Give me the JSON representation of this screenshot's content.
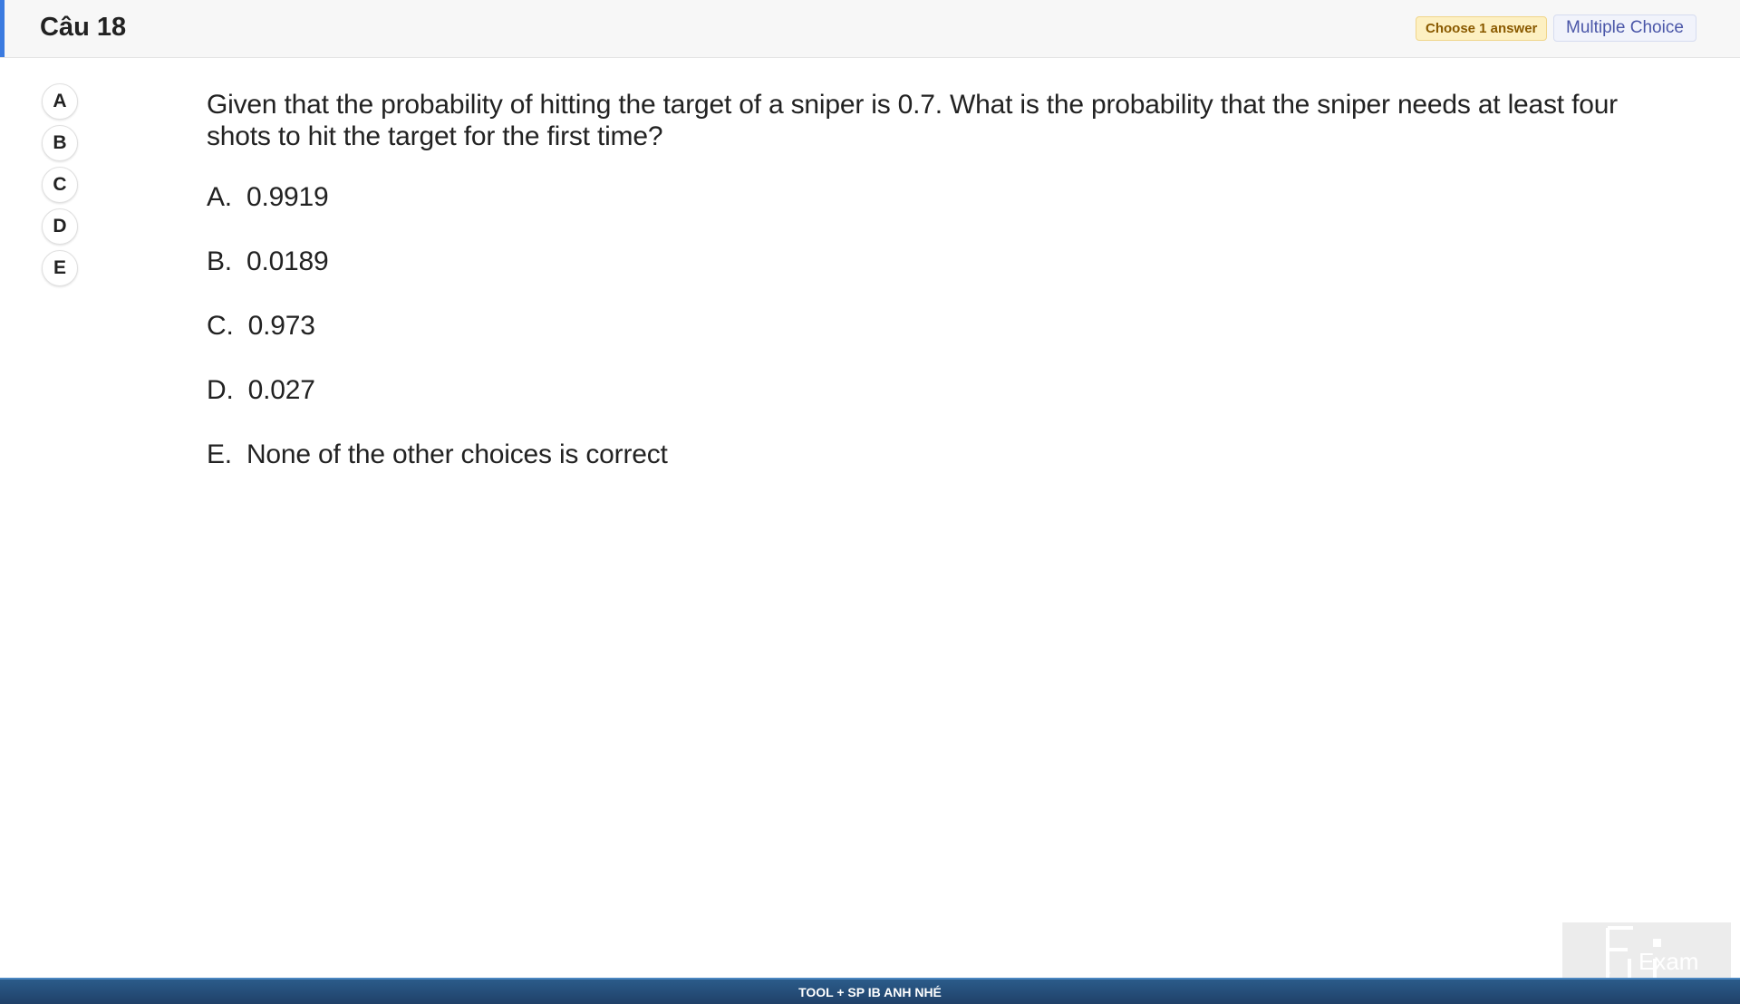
{
  "header": {
    "question_number": "Câu 18",
    "badge_choose": "Choose 1 answer",
    "badge_type": "Multiple Choice",
    "accent_color": "#3b7be0"
  },
  "answer_circles": [
    "A",
    "B",
    "C",
    "D",
    "E"
  ],
  "question": {
    "text": "Given that the probability of hitting the target of a sniper is 0.7. What is the probability that the sniper needs at least four shots to hit the target for the first time?",
    "options": [
      {
        "letter": "A.",
        "text": "0.9919"
      },
      {
        "letter": "B.",
        "text": "0.0189"
      },
      {
        "letter": "C.",
        "text": "0.973"
      },
      {
        "letter": "D.",
        "text": "0.027"
      },
      {
        "letter": "E.",
        "text": "None of the other choices is correct"
      }
    ]
  },
  "watermark": {
    "logo_text": "Exam",
    "icon": "fu-exam-logo"
  },
  "footer": {
    "text": "TOOL + SP IB ANH NHÉ"
  }
}
